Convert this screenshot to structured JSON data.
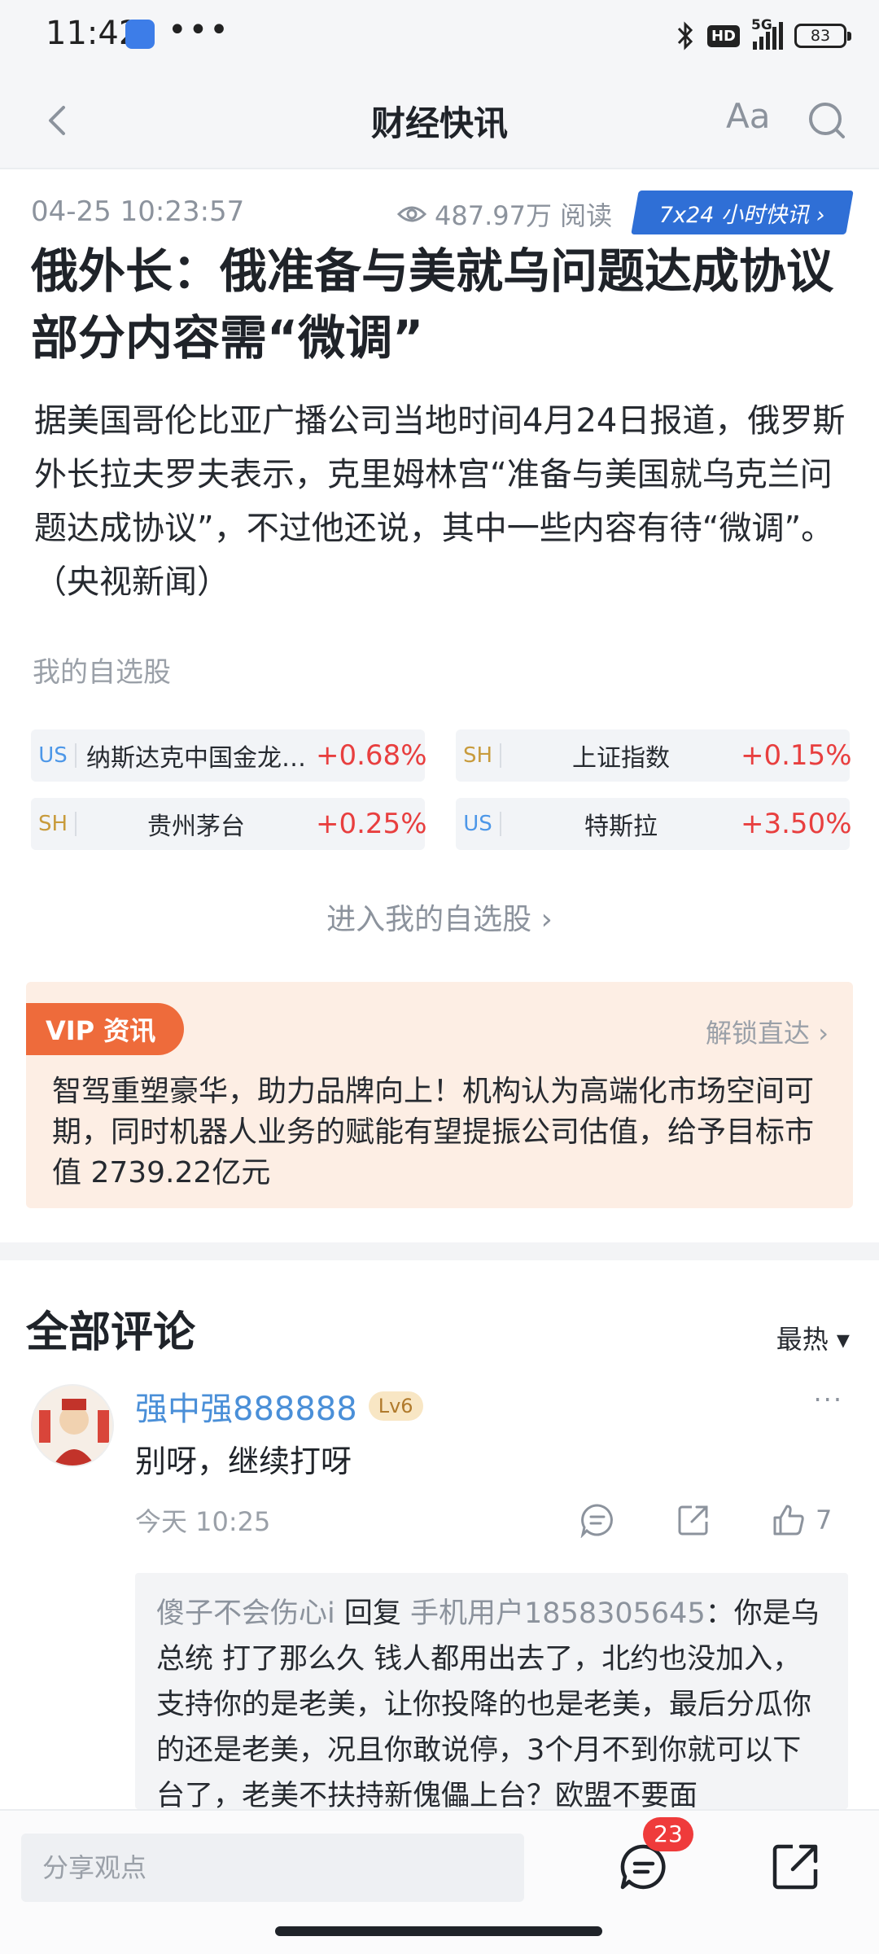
{
  "status_bar": {
    "time": "11:42",
    "dots": "•••",
    "network": "5G",
    "hd": "HD",
    "battery": "83"
  },
  "nav": {
    "title": "财经快讯",
    "font_btn": "Aa"
  },
  "article": {
    "datetime": "04-25 10:23:57",
    "views": "487.97万 阅读",
    "tag": "7x24 小时快讯 ›",
    "headline": "俄外长：俄准备与美就乌问题达成协议 部分内容需“微调”",
    "body": "据美国哥伦比亚广播公司当地时间4月24日报道，俄罗斯外长拉夫罗夫表示，克里姆林宫“准备与美国就乌克兰问题达成协议”，不过他还说，其中一些内容有待“微调”。（央视新闻）"
  },
  "watchlist": {
    "label": "我的自选股",
    "stocks": [
      {
        "market": "US",
        "name": "纳斯达克中国金龙…",
        "change": "+0.68%"
      },
      {
        "market": "SH",
        "name": "上证指数",
        "change": "+0.15%"
      },
      {
        "market": "SH",
        "name": "贵州茅台",
        "change": "+0.25%"
      },
      {
        "market": "US",
        "name": "特斯拉",
        "change": "+3.50%"
      }
    ],
    "enter": "进入我的自选股 ›"
  },
  "vip": {
    "badge": "VIP 资讯",
    "unlock": "解锁直达 ›",
    "text": "智驾重塑豪华，助力品牌向上！机构认为高端化市场空间可期，同时机器人业务的赋能有望提振公司估值，给予目标市值 2739.22亿元"
  },
  "comments": {
    "title": "全部评论",
    "sort": "最热 ▾",
    "items": [
      {
        "user": "强中强888888",
        "level": "Lv6",
        "more": "···",
        "text": "别呀，继续打呀",
        "time": "今天 10:25",
        "likes": "7",
        "reply": {
          "from": "傻子不会伤心i",
          "verb": "回复",
          "to": "手机用户1858305645",
          "text": "：你是乌总统 打了那么久 钱人都用出去了，北约也没加入，支持你的是老美，让你投降的也是老美，最后分瓜你的还是老美，况且你敢说停，3个月不到你就可以下台了，老美不扶持新傀儡上台？欧盟不要面"
        }
      }
    ]
  },
  "bottom_bar": {
    "placeholder": "分享观点",
    "comment_count": "23"
  },
  "colors": {
    "accent_blue": "#2f6fd6",
    "rise_red": "#e83f3f",
    "vip_orange": "#ee6b3b"
  }
}
